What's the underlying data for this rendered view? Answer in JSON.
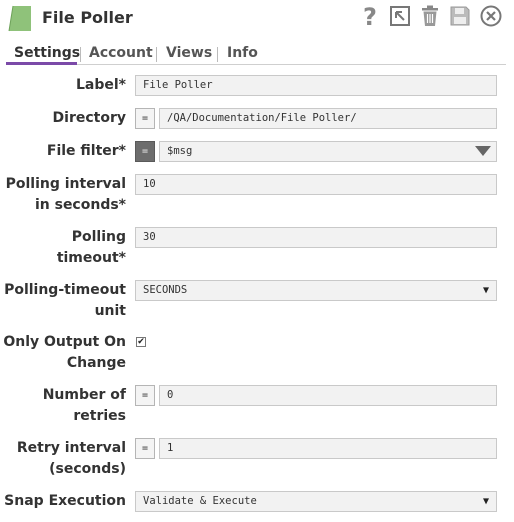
{
  "header": {
    "title": "File Poller"
  },
  "toolbar": {
    "icons": [
      "help-icon",
      "export-icon",
      "delete-icon",
      "save-icon",
      "close-icon"
    ],
    "help_glyph": "?"
  },
  "tabs": [
    {
      "label": "Settings",
      "active": true
    },
    {
      "label": "Account",
      "active": false
    },
    {
      "label": "Views",
      "active": false
    },
    {
      "label": "Info",
      "active": false
    }
  ],
  "form": {
    "label": {
      "name": "Label*",
      "value": "File Poller"
    },
    "directory": {
      "name": "Directory",
      "expr": "=",
      "value": "/QA/Documentation/File Poller/"
    },
    "file_filter": {
      "name": "File filter*",
      "expr": "=",
      "value": "$msg"
    },
    "polling_interval": {
      "name_line1": "Polling interval",
      "name_line2": "in seconds*",
      "value": "10"
    },
    "polling_timeout": {
      "name_line1": "Polling",
      "name_line2": "timeout*",
      "value": "30"
    },
    "polling_timeout_unit": {
      "name_line1": "Polling-timeout",
      "name_line2": "unit",
      "value": "SECONDS"
    },
    "only_output_on_change": {
      "name_line1": "Only Output On",
      "name_line2": "Change",
      "checked": true,
      "mark": "✔"
    },
    "number_of_retries": {
      "name_line1": "Number of",
      "name_line2": "retries",
      "expr": "=",
      "value": "0"
    },
    "retry_interval": {
      "name_line1": "Retry interval",
      "name_line2": "(seconds)",
      "expr": "=",
      "value": "1"
    },
    "snap_execution": {
      "name": "Snap Execution",
      "value": "Validate & Execute"
    }
  },
  "colors": {
    "accent": "#7b4aa8",
    "snap_icon": "#8fc27a",
    "field_bg": "#f2f2f2"
  },
  "dropdown_caret": "▼"
}
